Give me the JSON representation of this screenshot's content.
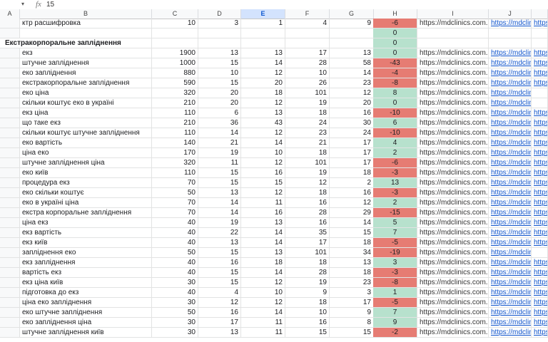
{
  "formula_bar": {
    "cell_dropdown": "▾",
    "fx_label": "fx",
    "value": "15"
  },
  "columns": [
    "A",
    "B",
    "C",
    "D",
    "E",
    "F",
    "G",
    "H",
    "I",
    "J",
    ""
  ],
  "colors": {
    "positive": "#b7e1cd",
    "negative": "#e67c73"
  },
  "rows": [
    {
      "kw": "ктр расшифровка",
      "c": "10",
      "d": "3",
      "e": "1",
      "f": "4",
      "g": "9",
      "h": "-6",
      "tone": "neg",
      "i": "https://mdclinics.com.ua/c",
      "j": "https://mdclinics",
      "k": "https:/"
    },
    {
      "kw": "",
      "c": "",
      "d": "",
      "e": "",
      "f": "",
      "g": "",
      "h": "0",
      "tone": "pos",
      "i": "",
      "j": "",
      "k": ""
    },
    {
      "kw": "Екстракорпоральне запліднення",
      "section": true,
      "c": "",
      "d": "",
      "e": "",
      "f": "",
      "g": "",
      "h": "0",
      "tone": "pos",
      "i": "",
      "j": "",
      "k": ""
    },
    {
      "kw": "екз",
      "c": "1900",
      "d": "13",
      "e": "13",
      "f": "17",
      "g": "13",
      "h": "0",
      "tone": "pos",
      "i": "https://mdclinics.com.ua/c",
      "j": "https://mdclinics",
      "k": "https:/"
    },
    {
      "kw": "штучне запліднення",
      "c": "1000",
      "d": "15",
      "e": "14",
      "f": "28",
      "g": "58",
      "h": "-43",
      "tone": "neg",
      "i": "https://mdclinics.com.ua/c",
      "j": "https://mdclinics",
      "k": "https:/"
    },
    {
      "kw": "еко запліднення",
      "c": "880",
      "d": "10",
      "e": "12",
      "f": "10",
      "g": "14",
      "h": "-4",
      "tone": "neg",
      "i": "https://mdclinics.com.ua/c",
      "j": "https://mdclinics",
      "k": "https:/"
    },
    {
      "kw": "екстракорпоральне запліднення",
      "c": "590",
      "d": "15",
      "e": "20",
      "f": "26",
      "g": "23",
      "h": "-8",
      "tone": "neg",
      "i": "https://mdclinics.com.ua/c",
      "j": "https://mdclinics",
      "k": "https:/"
    },
    {
      "kw": "еко ціна",
      "c": "320",
      "d": "20",
      "e": "18",
      "f": "101",
      "g": "12",
      "h": "8",
      "tone": "pos",
      "i": "https://mdclinics.com.ua/c",
      "j": "https://mdclinics",
      "k": ""
    },
    {
      "kw": "скільки коштує еко в україні",
      "c": "210",
      "d": "20",
      "e": "12",
      "f": "19",
      "g": "20",
      "h": "0",
      "tone": "pos",
      "i": "https://mdclinics.com.ua/c",
      "j": "https://mdclinics",
      "k": ""
    },
    {
      "kw": "екз ціна",
      "c": "110",
      "d": "6",
      "e": "13",
      "f": "18",
      "g": "16",
      "h": "-10",
      "tone": "neg",
      "i": "https://mdclinics.com.ua/c",
      "j": "https://mdclinics",
      "k": "https:/"
    },
    {
      "kw": "що таке екз",
      "c": "210",
      "d": "36",
      "e": "43",
      "f": "24",
      "g": "30",
      "h": "6",
      "tone": "pos",
      "i": "https://mdclinics.com.ua/c",
      "j": "https://mdclinics",
      "k": "https:/"
    },
    {
      "kw": "скільки коштує штучне запліднення",
      "c": "110",
      "d": "14",
      "e": "12",
      "f": "23",
      "g": "24",
      "h": "-10",
      "tone": "neg",
      "i": "https://mdclinics.com.ua/c",
      "j": "https://mdclinics",
      "k": "https:/"
    },
    {
      "kw": "еко вартість",
      "c": "140",
      "d": "21",
      "e": "14",
      "f": "21",
      "g": "17",
      "h": "4",
      "tone": "pos",
      "i": "https://mdclinics.com.ua/c",
      "j": "https://mdclinics",
      "k": "https:/"
    },
    {
      "kw": "ціна еко",
      "c": "170",
      "d": "19",
      "e": "10",
      "f": "18",
      "g": "17",
      "h": "2",
      "tone": "pos",
      "i": "https://mdclinics.com.ua/c",
      "j": "https://mdclinics",
      "k": "https:/"
    },
    {
      "kw": "штучне запліднення ціна",
      "c": "320",
      "d": "11",
      "e": "12",
      "f": "101",
      "g": "17",
      "h": "-6",
      "tone": "neg",
      "i": "https://mdclinics.com.ua/c",
      "j": "https://mdclinics",
      "k": "https:/"
    },
    {
      "kw": "еко київ",
      "c": "110",
      "d": "15",
      "e": "16",
      "f": "19",
      "g": "18",
      "h": "-3",
      "tone": "neg",
      "i": "https://mdclinics.com.ua/c",
      "j": "https://mdclinics",
      "k": "https:/"
    },
    {
      "kw": "процедура екз",
      "c": "70",
      "d": "15",
      "e": "15",
      "f": "12",
      "g": "2",
      "h": "13",
      "tone": "pos",
      "i": "https://mdclinics.com.ua/c",
      "j": "https://mdclinics",
      "k": "https:/"
    },
    {
      "kw": "еко скільки коштує",
      "c": "50",
      "d": "13",
      "e": "12",
      "f": "18",
      "g": "16",
      "h": "-3",
      "tone": "neg",
      "i": "https://mdclinics.com.ua/c",
      "j": "https://mdclinics",
      "k": "https:/"
    },
    {
      "kw": "еко в україні ціна",
      "c": "70",
      "d": "14",
      "e": "11",
      "f": "16",
      "g": "12",
      "h": "2",
      "tone": "pos",
      "i": "https://mdclinics.com.ua/c",
      "j": "https://mdclinics",
      "k": "https:/"
    },
    {
      "kw": "екстра корпоральне запліднення",
      "c": "70",
      "d": "14",
      "e": "16",
      "f": "28",
      "g": "29",
      "h": "-15",
      "tone": "neg",
      "i": "https://mdclinics.com.ua/c",
      "j": "https://mdclinics",
      "k": "https:/"
    },
    {
      "kw": "ціна екз",
      "c": "40",
      "d": "19",
      "e": "13",
      "f": "16",
      "g": "14",
      "h": "5",
      "tone": "pos",
      "i": "https://mdclinics.com.ua/c",
      "j": "https://mdclinics",
      "k": "https:/"
    },
    {
      "kw": "екз вартість",
      "c": "40",
      "d": "22",
      "e": "14",
      "f": "35",
      "g": "15",
      "h": "7",
      "tone": "pos",
      "i": "https://mdclinics.com.ua/c",
      "j": "https://mdclinics",
      "k": "https:/"
    },
    {
      "kw": "екз київ",
      "c": "40",
      "d": "13",
      "e": "14",
      "f": "17",
      "g": "18",
      "h": "-5",
      "tone": "neg",
      "i": "https://mdclinics.com.ua/c",
      "j": "https://mdclinics",
      "k": "https:/"
    },
    {
      "kw": "запліднення еко",
      "c": "50",
      "d": "15",
      "e": "13",
      "f": "101",
      "g": "34",
      "h": "-19",
      "tone": "neg",
      "i": "https://mdclinics.com.ua/c",
      "j": "https://mdclinics",
      "k": ""
    },
    {
      "kw": "екз запліднення",
      "c": "40",
      "d": "16",
      "e": "18",
      "f": "18",
      "g": "13",
      "h": "3",
      "tone": "pos",
      "i": "https://mdclinics.com.ua/c",
      "j": "https://mdclinics",
      "k": "https:/"
    },
    {
      "kw": "вартість екз",
      "c": "40",
      "d": "15",
      "e": "14",
      "f": "28",
      "g": "18",
      "h": "-3",
      "tone": "neg",
      "i": "https://mdclinics.com.ua/c",
      "j": "https://mdclinics",
      "k": "https:/"
    },
    {
      "kw": "екз ціна київ",
      "c": "30",
      "d": "15",
      "e": "12",
      "f": "19",
      "g": "23",
      "h": "-8",
      "tone": "neg",
      "i": "https://mdclinics.com.ua/c",
      "j": "https://mdclinics",
      "k": "https:/"
    },
    {
      "kw": "підготовка до екз",
      "c": "40",
      "d": "4",
      "e": "10",
      "f": "9",
      "g": "3",
      "h": "1",
      "tone": "pos",
      "i": "https://mdclinics.com.ua/c",
      "j": "https://mdclinics",
      "k": "https:/"
    },
    {
      "kw": "ціна еко запліднення",
      "c": "30",
      "d": "12",
      "e": "12",
      "f": "18",
      "g": "17",
      "h": "-5",
      "tone": "neg",
      "i": "https://mdclinics.com.ua/c",
      "j": "https://mdclinics",
      "k": "https:/"
    },
    {
      "kw": "еко штучне запліднення",
      "c": "50",
      "d": "16",
      "e": "14",
      "f": "10",
      "g": "9",
      "h": "7",
      "tone": "pos",
      "i": "https://mdclinics.com.ua/c",
      "j": "https://mdclinics",
      "k": "https:/"
    },
    {
      "kw": "еко запліднення ціна",
      "c": "30",
      "d": "17",
      "e": "11",
      "f": "16",
      "g": "8",
      "h": "9",
      "tone": "pos",
      "i": "https://mdclinics.com.ua/c",
      "j": "https://mdclinics",
      "k": "https:/"
    },
    {
      "kw": "штучне запліднення київ",
      "c": "30",
      "d": "13",
      "e": "11",
      "f": "15",
      "g": "15",
      "h": "-2",
      "tone": "neg",
      "i": "https://mdclinics.com.ua/c",
      "j": "https://mdclinics",
      "k": "https:/"
    }
  ]
}
